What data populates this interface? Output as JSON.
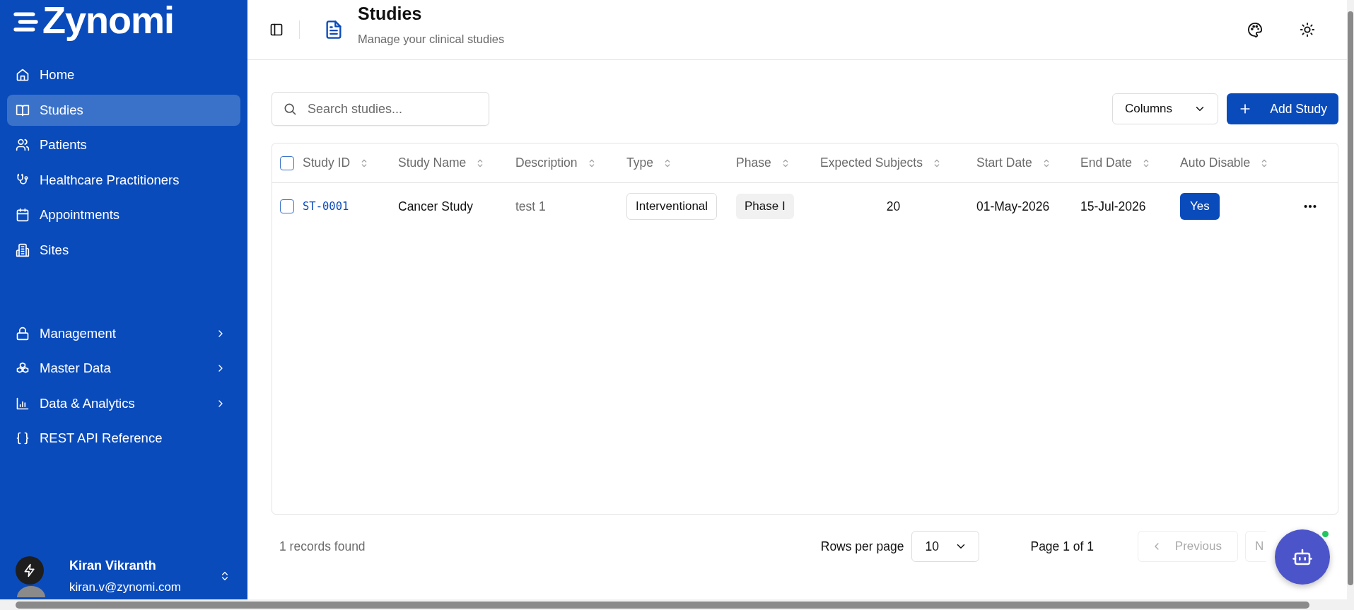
{
  "sidebar": {
    "logo": "Zynomi",
    "nav": [
      {
        "label": "Home",
        "selected": false
      },
      {
        "label": "Studies",
        "selected": true
      },
      {
        "label": "Patients",
        "selected": false
      },
      {
        "label": "Healthcare Practitioners",
        "selected": false
      },
      {
        "label": "Appointments",
        "selected": false
      },
      {
        "label": "Sites",
        "selected": false
      }
    ],
    "sections": [
      {
        "label": "Management",
        "expandable": true
      },
      {
        "label": "Master Data",
        "expandable": true
      },
      {
        "label": "Data & Analytics",
        "expandable": true
      },
      {
        "label": "REST API Reference",
        "expandable": false
      }
    ],
    "user": {
      "name": "Kiran Vikranth",
      "email": "kiran.v@zynomi.com"
    }
  },
  "header": {
    "title": "Studies",
    "subtitle": "Manage your clinical studies"
  },
  "toolbar": {
    "search": {
      "placeholder": "Search studies..."
    },
    "columns_button": "Columns",
    "add_button": "Add Study"
  },
  "table": {
    "select_all": {
      "checked": false
    },
    "columns": [
      "Study ID",
      "Study Name",
      "Description",
      "Type",
      "Phase",
      "Expected Subjects",
      "Start Date",
      "End Date",
      "Auto Disable"
    ],
    "rows": [
      {
        "selected": false,
        "cells": [
          {
            "kind": "link",
            "text": "ST-0001"
          },
          {
            "kind": "text",
            "text": "Cancer Study"
          },
          {
            "kind": "muted",
            "text": "test 1"
          },
          {
            "kind": "outline",
            "text": "Interventional"
          },
          {
            "kind": "grey",
            "text": "Phase I"
          },
          {
            "kind": "number",
            "text": "20"
          },
          {
            "kind": "text",
            "text": "01-May-2026"
          },
          {
            "kind": "text",
            "text": "15-Jul-2026"
          },
          {
            "kind": "pill",
            "text": "Yes"
          }
        ]
      }
    ]
  },
  "footer": {
    "records": "1 records found",
    "rows_per_page_label": "Rows per page",
    "rows_per_page": "10",
    "page_info": "Page 1 of 1",
    "previous": {
      "label": "Previous",
      "disabled": true
    },
    "next": {
      "label": "N",
      "disabled": true
    }
  },
  "assistant": {
    "online": true
  }
}
